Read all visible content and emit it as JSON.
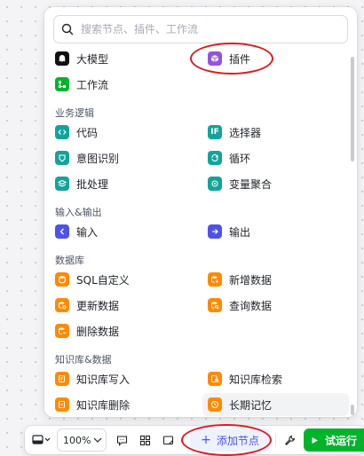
{
  "search": {
    "placeholder": "搜索节点、插件、工作流"
  },
  "top_items": {
    "llm": "大模型",
    "plugin": "插件",
    "workflow": "工作流"
  },
  "sections": {
    "logic": {
      "title": "业务逻辑",
      "code": "代码",
      "selector": "选择器",
      "intent": "意图识别",
      "loop": "循环",
      "batch": "批处理",
      "var_agg": "变量聚合"
    },
    "io": {
      "title": "输入&输出",
      "input": "输入",
      "output": "输出"
    },
    "db": {
      "title": "数据库",
      "sql": "SQL自定义",
      "add": "新增数据",
      "update": "更新数据",
      "query": "查询数据",
      "delete": "删除数据"
    },
    "kb": {
      "title": "知识库&数据",
      "write": "知识库写入",
      "search": "知识库检索",
      "remove": "知识库删除",
      "memory": "长期记忆"
    }
  },
  "toolbar": {
    "zoom": "100%",
    "add_node": "添加节点",
    "add_icon": "+",
    "run": "试运行"
  },
  "colors": {
    "accent": "#4d53e8",
    "run": "#00b42a",
    "orange": "#ff8a00",
    "teal": "#14a39a",
    "plugin": "#9254de",
    "input": "#4d53e8",
    "highlight_ring": "#e0191e"
  }
}
